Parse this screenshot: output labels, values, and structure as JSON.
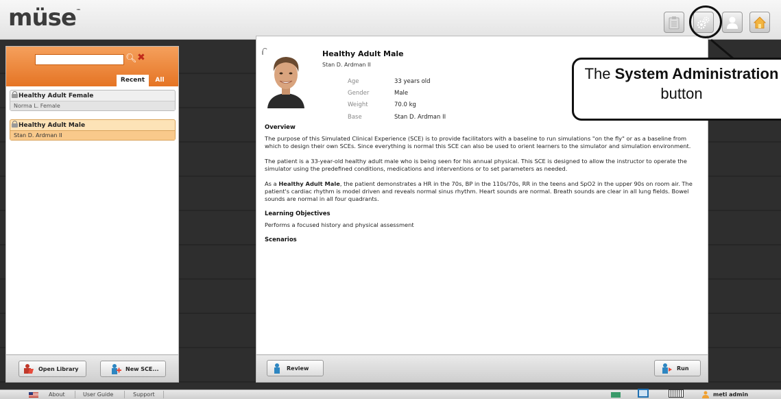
{
  "app": {
    "logo": "müse",
    "logo_tm": "™"
  },
  "toolbar": {
    "buttons": [
      "clipboard-icon",
      "gear-icon",
      "user-icon",
      "home-icon"
    ]
  },
  "library": {
    "search": {
      "value": "",
      "placeholder": ""
    },
    "tabs": [
      {
        "label": "Recent",
        "active": true
      },
      {
        "label": "All",
        "active": false
      }
    ],
    "items": [
      {
        "title": "Healthy Adult Female",
        "subtitle": "Norma L. Female",
        "selected": false,
        "locked": true
      },
      {
        "title": "Healthy Adult Male",
        "subtitle": "Stan D. Ardman II",
        "selected": true,
        "locked": true
      }
    ],
    "open_library_label": "Open Library",
    "new_sce_label": "New SCE..."
  },
  "detail": {
    "title": "Healthy Adult Male",
    "author": "Stan D. Ardman II",
    "fields": [
      {
        "key": "Age",
        "value": "33 years old"
      },
      {
        "key": "Gender",
        "value": "Male"
      },
      {
        "key": "Weight",
        "value": "70.0 kg"
      },
      {
        "key": "Base",
        "value": "Stan D. Ardman II"
      }
    ],
    "overview_heading": "Overview",
    "overview_p1": "The purpose of this Simulated Clinical Experience (SCE) is to provide facilitators with a baseline to run simulations \"on the fly\" or as a baseline from which to design their own SCEs. Since everything is normal this SCE can also be used to orient learners to the simulator and simulation environment.",
    "overview_p2": "The patient is a 33-year-old healthy adult male who is being seen for his annual physical. This SCE is designed to allow the instructor to operate the simulator using the predefined conditions, medications and interventions or to set parameters as needed.",
    "overview_p3_prefix": "As a ",
    "overview_p3_bold": "Healthy Adult Male",
    "overview_p3_rest": ", the patient demonstrates a HR in the 70s, BP in the 110s/70s, RR in the teens and SpO2 in the upper 90s on room air. The patient's cardiac rhythm is model driven and reveals normal sinus rhythm. Heart sounds are normal. Breath sounds are clear in all lung fields. Bowel sounds are normal in all four quadrants.",
    "objectives_heading": "Learning Objectives",
    "objectives_text": "Performs a focused history and physical assessment",
    "scenarios_heading": "Scenarios",
    "review_label": "Review",
    "run_label": "Run"
  },
  "callout": {
    "prefix": "The ",
    "bold": "System Administration",
    "suffix": " button"
  },
  "statusbar": {
    "links": [
      "About",
      "User Guide",
      "Support"
    ],
    "user": "meti admin"
  },
  "colors": {
    "accent": "#e57424",
    "selected": "#fde3b7",
    "link": "#1f6fb0"
  }
}
